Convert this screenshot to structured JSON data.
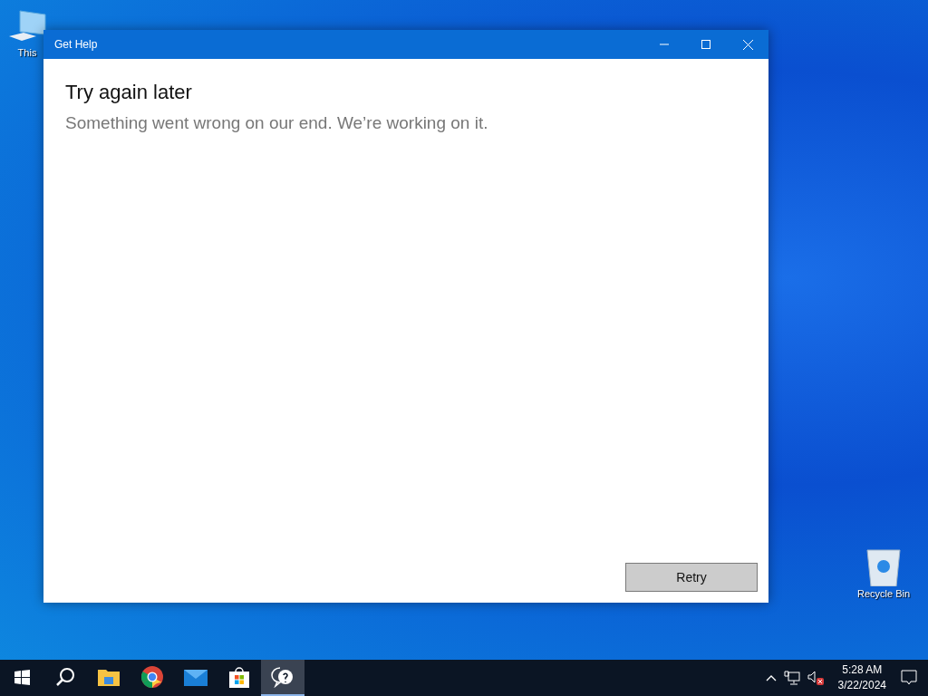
{
  "desktop_icons": [
    {
      "kind": "computer",
      "label": "This"
    },
    {
      "kind": "recycle",
      "label": "Recycle Bin"
    }
  ],
  "window": {
    "title": "Get Help",
    "heading": "Try again later",
    "message": "Something went wrong on our end. We’re working on it.",
    "button": "Retry"
  },
  "taskbar": {
    "items": [
      {
        "kind": "start",
        "selected": false
      },
      {
        "kind": "search",
        "selected": false
      },
      {
        "kind": "folder",
        "selected": false
      },
      {
        "kind": "chrome",
        "selected": false
      },
      {
        "kind": "mail",
        "selected": false
      },
      {
        "kind": "store",
        "selected": false
      },
      {
        "kind": "help",
        "selected": true
      }
    ],
    "time": "5:28 AM",
    "date": "3/22/2024"
  }
}
